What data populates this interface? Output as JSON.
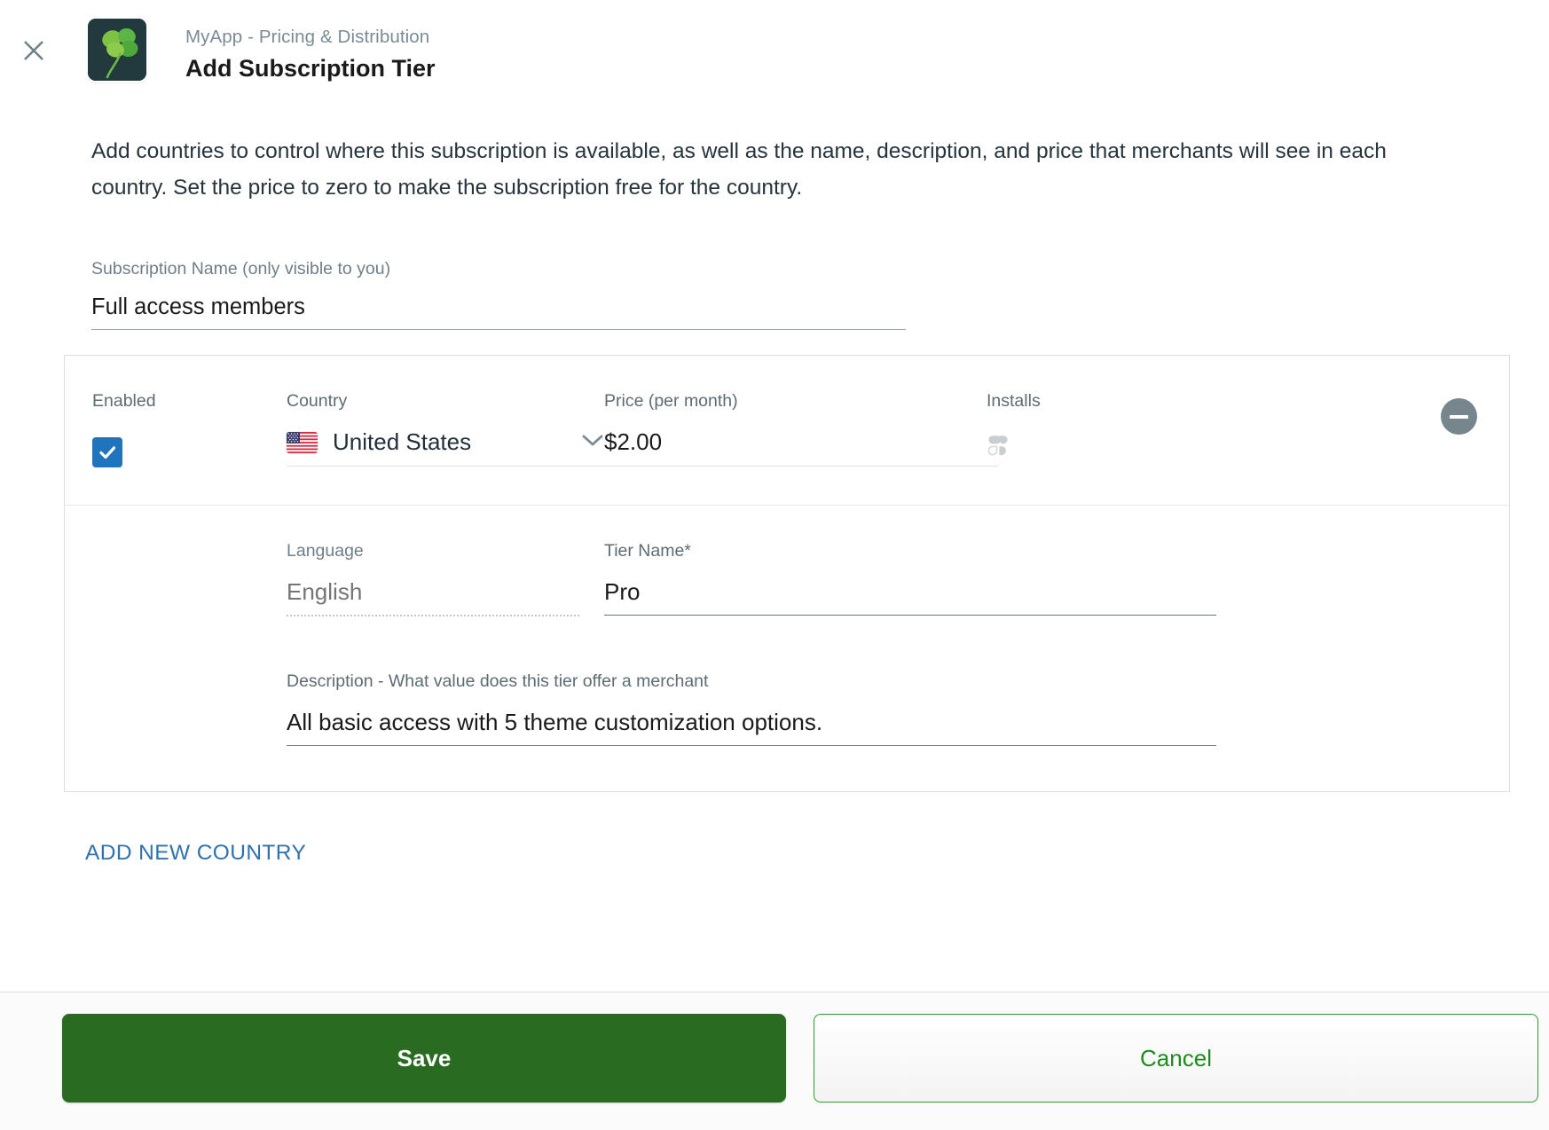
{
  "header": {
    "close_icon": "close-icon",
    "app_icon": "four-leaf-clover-app-icon",
    "breadcrumb": "MyApp - Pricing & Distribution",
    "title": "Add Subscription Tier"
  },
  "intro": {
    "text": "Add countries to control where this subscription is available, as well as the name, description, and price that merchants will see in each country. Set the price to zero to make the subscription free for the country."
  },
  "subscription_name": {
    "label": "Subscription Name (only visible to you)",
    "value": "Full access members",
    "placeholder": ""
  },
  "country_card": {
    "columns": {
      "enabled": "Enabled",
      "country": "Country",
      "price": "Price (per month)",
      "installs": "Installs"
    },
    "row": {
      "enabled_checked": true,
      "checkbox_color": "#1f74bb",
      "flag": "us-flag-icon",
      "country_value": "United States",
      "dropdown_icon": "chevron-down-icon",
      "price_value": "$2.00",
      "price_placeholder": "",
      "installs_icon": "clover-spinner-icon",
      "installs_value": "",
      "remove_icon": "minus-circle-icon"
    },
    "language": {
      "label": "Language",
      "value": "English",
      "placeholder": "English"
    },
    "tier_name": {
      "label": "Tier Name*",
      "value": "Pro",
      "placeholder": ""
    },
    "description": {
      "label": "Description - What value does this tier offer a merchant",
      "value": "All basic access with 5 theme customization options.",
      "placeholder": ""
    }
  },
  "add_country_link": "ADD NEW COUNTRY",
  "footer": {
    "save_label": "Save",
    "cancel_label": "Cancel",
    "save_color": "#2a6b22",
    "cancel_color": "#1f8b1f"
  }
}
